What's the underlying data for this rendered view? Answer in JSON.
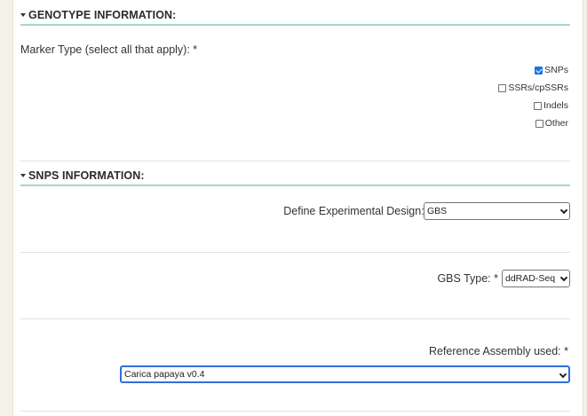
{
  "genotype": {
    "header": "GENOTYPE INFORMATION:",
    "marker_label": "Marker Type (select all that apply): *",
    "markers": [
      {
        "label": "SNPs",
        "checked": true
      },
      {
        "label": "SSRs/cpSSRs",
        "checked": false
      },
      {
        "label": "Indels",
        "checked": false
      },
      {
        "label": "Other",
        "checked": false
      }
    ]
  },
  "snps": {
    "header": "SNPS INFORMATION:",
    "design_label": "Define Experimental Design: *",
    "design_value": "GBS",
    "gbs_label": "GBS Type: *",
    "gbs_value": "ddRAD-Seq",
    "assembly_label": "Reference Assembly used: *",
    "assembly_value": "Carica papaya v0.4"
  }
}
